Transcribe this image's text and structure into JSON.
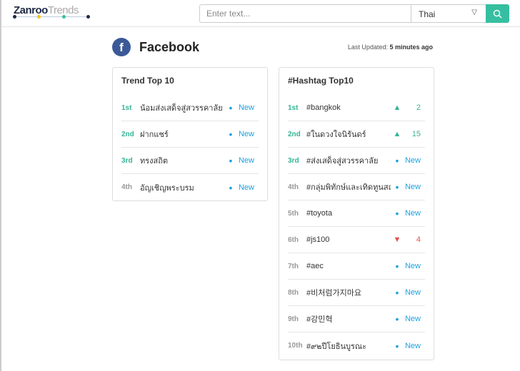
{
  "header": {
    "logo_brand": "Zanroo",
    "logo_product": "Trends",
    "search_placeholder": "Enter text...",
    "language": "Thai",
    "language_arrow": "▽"
  },
  "page": {
    "title": "Facebook",
    "last_updated_label": "Last Updated:",
    "last_updated_value": "5 minutes ago"
  },
  "trend": {
    "title": "Trend Top 10",
    "items": [
      {
        "rank": "1st",
        "name": "น้อมส่งเสด็จสู่สวรรคาลัย",
        "status": "New"
      },
      {
        "rank": "2nd",
        "name": "ฝากแชร์",
        "status": "New"
      },
      {
        "rank": "3rd",
        "name": "ทรงสถิต",
        "status": "New"
      },
      {
        "rank": "4th",
        "name": "อัญเชิญพระบรม",
        "status": "New"
      }
    ]
  },
  "hashtag": {
    "title": "#Hashtag Top10",
    "items": [
      {
        "rank": "1st",
        "name": "#bangkok",
        "dir": "up",
        "status": "2"
      },
      {
        "rank": "2nd",
        "name": "#ในดวงใจนิรันดร์",
        "dir": "up",
        "status": "15"
      },
      {
        "rank": "3rd",
        "name": "#ส่งเสด็จสู่สวรรคาลัย",
        "dir": "new",
        "status": "New"
      },
      {
        "rank": "4th",
        "name": "#กลุ่มพิทักษ์และเทิดทูนสถาบัน",
        "dir": "new",
        "status": "New"
      },
      {
        "rank": "5th",
        "name": "#toyota",
        "dir": "new",
        "status": "New"
      },
      {
        "rank": "6th",
        "name": "#js100",
        "dir": "down",
        "status": "4"
      },
      {
        "rank": "7th",
        "name": "#aec",
        "dir": "new",
        "status": "New"
      },
      {
        "rank": "8th",
        "name": "#비처럼가지마요",
        "dir": "new",
        "status": "New"
      },
      {
        "rank": "9th",
        "name": "#강민혁",
        "dir": "new",
        "status": "New"
      },
      {
        "rank": "10th",
        "name": "#๙๒ปีโยธินบูรณะ",
        "dir": "new",
        "status": "New"
      }
    ]
  },
  "colors": {
    "accent": "#35bfa0",
    "facebook": "#3b5998",
    "new": "#1da1e0",
    "down": "#e94d4d"
  }
}
